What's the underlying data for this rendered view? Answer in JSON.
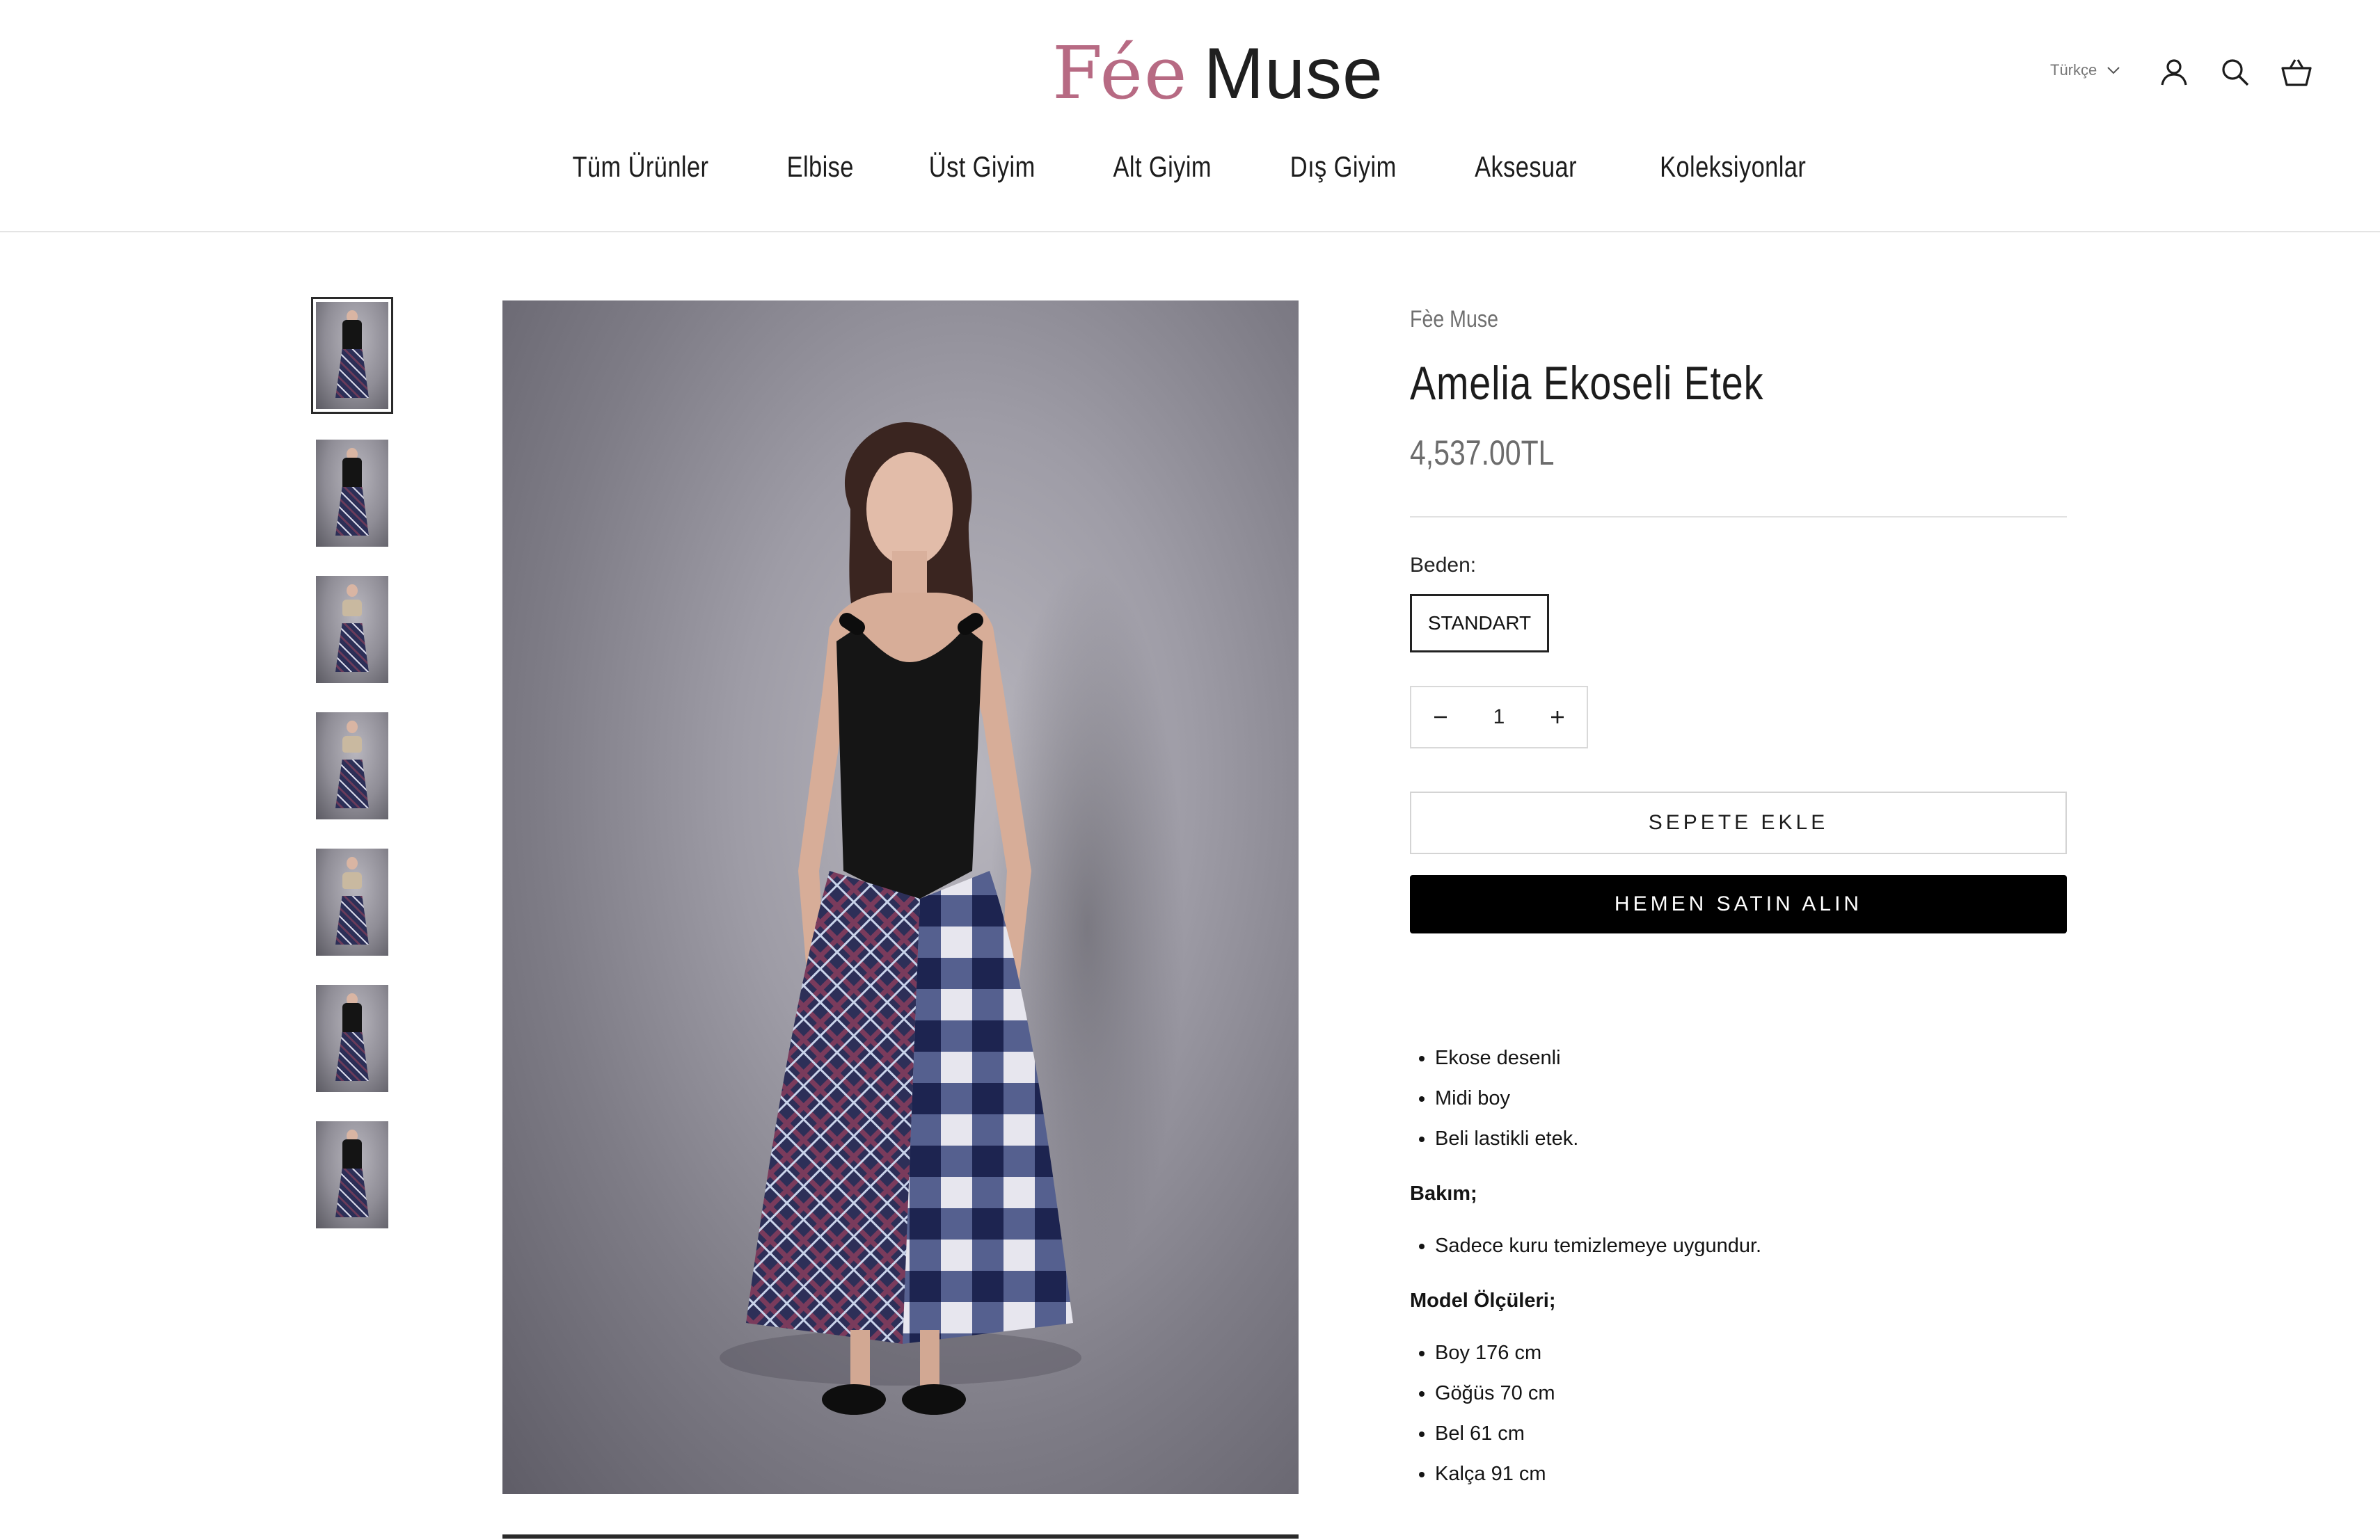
{
  "brand": {
    "logo_part1": "Fée",
    "logo_part2": "Muse",
    "accent_color": "#b76a83"
  },
  "header": {
    "language": "Türkçe",
    "icons": [
      "account-icon",
      "search-icon",
      "cart-icon"
    ]
  },
  "nav": {
    "items": [
      "Tüm Ürünler",
      "Elbise",
      "Üst Giyim",
      "Alt Giyim",
      "Dış Giyim",
      "Aksesuar",
      "Koleksiyonlar"
    ]
  },
  "gallery": {
    "thumbnail_count": 7,
    "active_index": 0
  },
  "product": {
    "vendor": "Fèe Muse",
    "title": "Amelia Ekoseli Etek",
    "price": "4,537.00TL",
    "size_label": "Beden:",
    "size_option": "STANDART",
    "quantity": "1",
    "add_to_cart": "SEPETE EKLE",
    "buy_now": "HEMEN SATIN ALIN"
  },
  "description": {
    "features": [
      "Ekose desenli",
      "Midi boy",
      "Beli lastikli etek."
    ],
    "care_heading": "Bakım;",
    "care": [
      "Sadece kuru temizlemeye uygundur."
    ],
    "model_heading": "Model Ölçüleri;",
    "model": [
      "Boy 176 cm",
      "Göğüs 70 cm",
      "Bel 61 cm",
      "Kalça 91 cm"
    ]
  }
}
